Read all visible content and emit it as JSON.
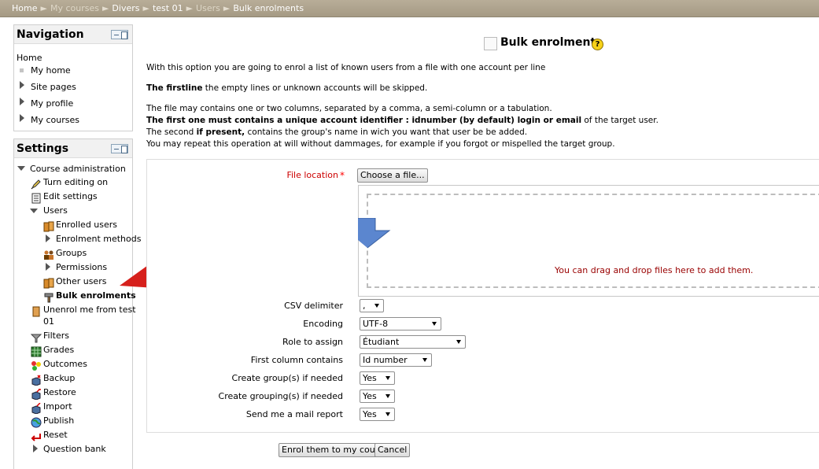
{
  "breadcrumb": [
    {
      "label": "Home",
      "dim": false
    },
    {
      "label": "My courses",
      "dim": true
    },
    {
      "label": "Divers",
      "dim": false
    },
    {
      "label": "test 01",
      "dim": false
    },
    {
      "label": "Users",
      "dim": true
    },
    {
      "label": "Bulk enrolments",
      "dim": false
    }
  ],
  "navigation": {
    "title": "Navigation",
    "home": "Home",
    "items": [
      "My home",
      "Site pages",
      "My profile",
      "My courses"
    ]
  },
  "settings": {
    "title": "Settings",
    "course_admin": "Course administration",
    "turn_editing": "Turn editing on",
    "edit_settings": "Edit settings",
    "users": "Users",
    "enrolled_users": "Enrolled users",
    "enrolment_methods": "Enrolment methods",
    "groups": "Groups",
    "permissions": "Permissions",
    "other_users": "Other users",
    "bulk_enrolments": "Bulk enrolments",
    "unenrol_line1": "Unenrol me from test",
    "unenrol_line2": "01",
    "filters": "Filters",
    "grades": "Grades",
    "outcomes": "Outcomes",
    "backup": "Backup",
    "restore": "Restore",
    "import": "Import",
    "publish": "Publish",
    "reset": "Reset",
    "question_bank": "Question bank"
  },
  "main": {
    "title": "Bulk enrolments",
    "help": "?",
    "intro1": "With this option you are going to enrol a list of known users from a file with one account per line",
    "intro2_bold": "The firstline",
    "intro2_rest": " the empty lines or unknown accounts will be skipped.",
    "intro3": "The file may contains one or two columns, separated by a comma, a semi-column or a tabulation.",
    "intro4_bold": "The first one must contains a unique account identifier : idnumber (by default) login or email",
    "intro4_rest": " of the target user.",
    "intro5_a": "The second ",
    "intro5_bold": "if present,",
    "intro5_rest": " contains the group's name in wich you want that user be be added.",
    "intro6": "You may repeat this operation at will without dammages, for example if you forgot or mispelled the target group."
  },
  "form": {
    "file_location_label": "File location",
    "required_mark": "*",
    "choose_file": "Choose a file...",
    "drop_text": "You can drag and drop files here to add them.",
    "csv_delimiter_label": "CSV delimiter",
    "csv_delimiter_value": ",",
    "encoding_label": "Encoding",
    "encoding_value": "UTF-8",
    "role_label": "Role to assign",
    "role_value": "Étudiant",
    "first_column_label": "First column contains",
    "first_column_value": "Id number",
    "create_groups_label": "Create group(s) if needed",
    "create_groups_value": "Yes",
    "create_groupings_label": "Create grouping(s) if needed",
    "create_groupings_value": "Yes",
    "mail_report_label": "Send me a mail report",
    "mail_report_value": "Yes",
    "submit": "Enrol them to my course",
    "cancel": "Cancel"
  },
  "colors": {
    "navbar": "#aca18c",
    "required": "#cc0000",
    "arrow": "#d6201c",
    "help_icon": "#f7d21a"
  }
}
